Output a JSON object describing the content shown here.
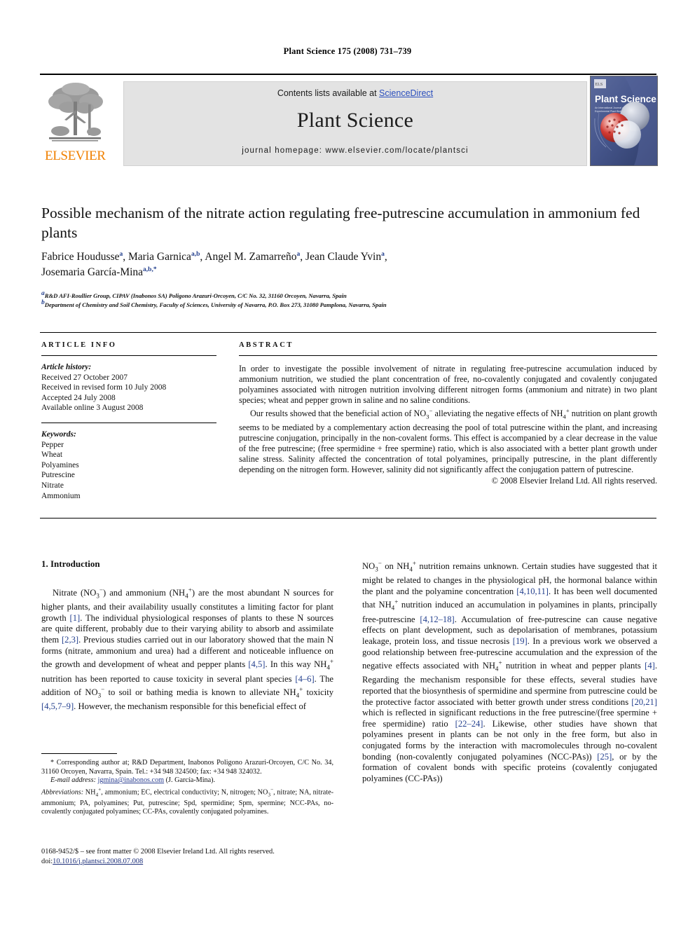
{
  "running_head": "Plant Science 175 (2008) 731–739",
  "masthead": {
    "contents_prefix": "Contents lists available at ",
    "sciencedirect": "ScienceDirect",
    "journal_name": "Plant Science",
    "homepage": "journal homepage: www.elsevier.com/locate/plantsci",
    "publisher": "ELSEVIER",
    "cover_title": "Plant Science",
    "cover_subtitle": "An International Journal of Experimental Plant Biology",
    "link_color": "#2a4ebd",
    "publisher_color": "#f08000"
  },
  "article": {
    "title": "Possible mechanism of the nitrate action regulating free-putrescine accumulation in ammonium fed plants",
    "authors": [
      {
        "name": "Fabrice Houdusse",
        "marks": "a",
        "sep": ", "
      },
      {
        "name": "Maria Garnica",
        "marks": "a,b",
        "sep": ", "
      },
      {
        "name": "Angel M. Zamarreño",
        "marks": "a",
        "sep": ", "
      },
      {
        "name": "Jean Claude Yvin",
        "marks": "a",
        "sep": ","
      },
      {
        "name": "Josemaria García-Mina",
        "marks": "a,b,*",
        "sep": ""
      }
    ],
    "affiliations": [
      {
        "mark": "a",
        "text": "R&D AFI-Roullier Group, CIPAV (Inabonos SA) Poligono Arazuri-Orcoyen, C/C No. 32, 31160 Orcoyen, Navarra, Spain"
      },
      {
        "mark": "b",
        "text": "Department of Chemistry and Soil Chemistry, Faculty of Sciences, University of Navarra, P.O. Box 273, 31080 Pamplona, Navarra, Spain"
      }
    ]
  },
  "article_info": {
    "label": "ARTICLE INFO",
    "history_heading": "Article history:",
    "history": [
      "Received 27 October 2007",
      "Received in revised form 10 July 2008",
      "Accepted 24 July 2008",
      "Available online 3 August 2008"
    ],
    "keywords_heading": "Keywords:",
    "keywords": [
      "Pepper",
      "Wheat",
      "Polyamines",
      "Putrescine",
      "Nitrate",
      "Ammonium"
    ]
  },
  "abstract": {
    "label": "ABSTRACT",
    "paragraph_1": "In order to investigate the possible involvement of nitrate in regulating free-putrescine accumulation induced by ammonium nutrition, we studied the plant concentration of free, no-covalently conjugated and covalently conjugated polyamines associated with nitrogen nutrition involving different nitrogen forms (ammonium and nitrate) in two plant species; wheat and pepper grown in saline and no saline conditions.",
    "paragraph_2_a": "Our results showed that the beneficial action of NO",
    "paragraph_2_b": " alleviating the negative effects of NH",
    "paragraph_2_c": " nutrition on plant growth seems to be mediated by a complementary action decreasing the pool of total putrescine within the plant, and increasing putrescine conjugation, principally in the non-covalent forms. This effect is accompanied by a clear decrease in the value of the free putrescine; (free spermidine + free spermine) ratio, which is also associated with a better plant growth under saline stress. Salinity affected the concentration of total polyamines, principally putrescine, in the plant differently depending on the nitrogen form. However, salinity did not significantly affect the conjugation pattern of putrescine.",
    "copyright": "© 2008 Elsevier Ireland Ltd. All rights reserved."
  },
  "introduction": {
    "heading": "1. Introduction",
    "left_p1_1": "Nitrate (NO",
    "left_p1_2": ") and ammonium (NH",
    "left_p1_3": ") are the most abundant N sources for higher plants, and their availability usually constitutes a limiting factor for plant growth ",
    "left_ref_1": "[1]",
    "left_p1_4": ". The individual physiological responses of plants to these N sources are quite different, probably due to their varying ability to absorb and assimilate them ",
    "left_ref_2": "[2,3]",
    "left_p1_5": ". Previous studies carried out in our laboratory showed that the main N forms (nitrate, ammonium and urea) had a different and noticeable influence on the growth and development of wheat and pepper plants ",
    "left_ref_3": "[4,5]",
    "left_p1_6": ". In this way NH",
    "left_p1_7": " nutrition has been reported to cause toxicity in several plant species ",
    "left_ref_4": "[4–6]",
    "left_p1_8": ". The addition of NO",
    "left_p1_9": " to soil or bathing media is known to alleviate NH",
    "left_p1_10": " toxicity ",
    "left_ref_5": "[4,5,7–9]",
    "left_p1_11": ". However, the mechanism responsible for this beneficial effect of",
    "right_1": "NO",
    "right_2": " on NH",
    "right_3": " nutrition remains unknown. Certain studies have suggested that it might be related to changes in the physiological pH, the hormonal balance within the plant and the polyamine concentration ",
    "right_ref_1": "[4,10,11]",
    "right_4": ". It has been well documented that NH",
    "right_5": " nutrition induced an accumulation in polyamines in plants, principally free-putrescine ",
    "right_ref_2": "[4,12–18]",
    "right_6": ". Accumulation of free-putrescine can cause negative effects on plant development, such as depolarisation of membranes, potassium leakage, protein loss, and tissue necrosis ",
    "right_ref_3": "[19]",
    "right_7": ". In a previous work we observed a good relationship between free-putrescine accumulation and the expression of the negative effects associated with NH",
    "right_8": " nutrition in wheat and pepper plants ",
    "right_ref_4": "[4]",
    "right_9": ". Regarding the mechanism responsible for these effects, several studies have reported that the biosynthesis of spermidine and spermine from putrescine could be the protective factor associated with better growth under stress conditions ",
    "right_ref_5": "[20,21]",
    "right_10": " which is reflected in significant reductions in the free putrescine/(free spermine + free spermidine) ratio ",
    "right_ref_6": "[22–24]",
    "right_11": ". Likewise, other studies have shown that polyamines present in plants can be not only in the free form, but also in conjugated forms by the interaction with macromolecules through no-covalent bonding (non-covalently conjugated polyamines (NCC-PAs)) ",
    "right_ref_7": "[25]",
    "right_12": ", or by the formation of covalent bonds with specific proteins (covalently conjugated polyamines (CC-PAs))"
  },
  "footnotes": {
    "corresponding": "* Corresponding author at; R&D Department, Inabonos Poligono Arazuri-Orcoyen, C/C No. 34, 31160 Orcoyen, Navarra, Spain. Tel.: +34 948 324500; fax: +34 948 324032.",
    "email_label": "E-mail address:",
    "email": "jgmina@inabonos.com",
    "email_owner": "(J. García-Mina).",
    "abbrev_label": "Abbreviations:",
    "abbrev_1": " NH",
    "abbrev_2": ", ammonium; EC, electrical conductivity; N, nitrogen; NO",
    "abbrev_3": ", nitrate; NA, nitrate-ammonium; PA, polyamines; Put, putrescine; Spd, spermidine; Spm, spermine; NCC-PAs, no-covalently conjugated polyamines; CC-PAs, covalently conjugated polyamines."
  },
  "imprint": {
    "line1": "0168-9452/$ – see front matter © 2008 Elsevier Ireland Ltd. All rights reserved.",
    "doi_label": "doi:",
    "doi": "10.1016/j.plantsci.2008.07.008"
  }
}
